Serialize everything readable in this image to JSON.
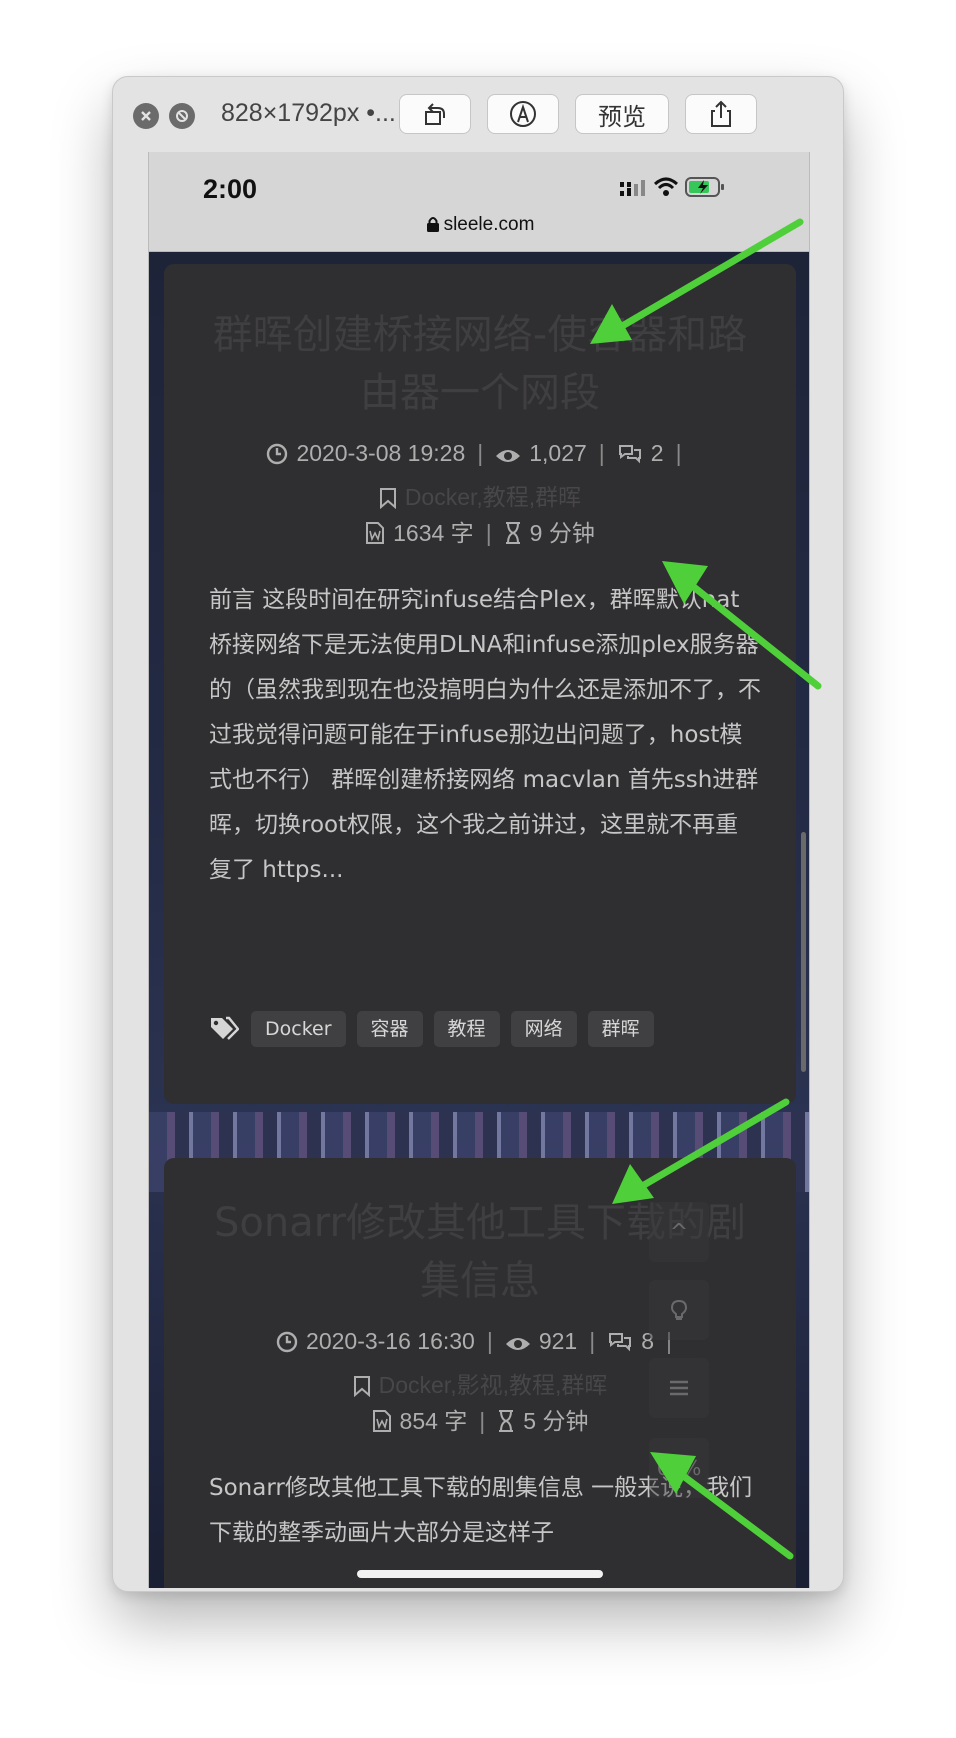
{
  "window": {
    "title": "828×1792px •...",
    "preview_label": "预览",
    "close_icon": "close-icon",
    "hide_icon": "hide-icon",
    "rotate_icon": "rotate-icon",
    "markup_icon": "markup-icon",
    "share_icon": "share-icon"
  },
  "statusbar": {
    "time": "2:00",
    "url": "sleele.com"
  },
  "posts": [
    {
      "title": "群晖创建桥接网络-使容器和路由器一个网段",
      "date": "2020-3-08 19:28",
      "views": "1,027",
      "comments": "2",
      "categories": "Docker,教程,群晖",
      "words": "1634 字",
      "read_time": "9 分钟",
      "excerpt": "前言 这段时间在研究infuse结合Plex，群晖默认nat桥接网络下是无法使用DLNA和infuse添加plex服务器的（虽然我到现在也没搞明白为什么还是添加不了，不过我觉得问题可能在于infuse那边出问题了，host模式也不行） 群晖创建桥接网络 macvlan 首先ssh进群晖，切换root权限，这个我之前讲过，这里就不再重复了 https...",
      "tags": [
        "Docker",
        "容器",
        "教程",
        "网络",
        "群晖"
      ]
    },
    {
      "title": "Sonarr修改其他工具下载的剧集信息",
      "date": "2020-3-16 16:30",
      "views": "921",
      "comments": "8",
      "categories": "Docker,影视,教程,群晖",
      "words": "854 字",
      "read_time": "5 分钟",
      "excerpt": "Sonarr修改其他工具下载的剧集信息 一般来说，我们下载的整季动画片大部分是这样子"
    }
  ],
  "float": {
    "up": "^",
    "percent": "66%"
  },
  "colors": {
    "card": "#2f2e30",
    "arrow": "#4fcf3a",
    "tag_bg": "#404042"
  }
}
